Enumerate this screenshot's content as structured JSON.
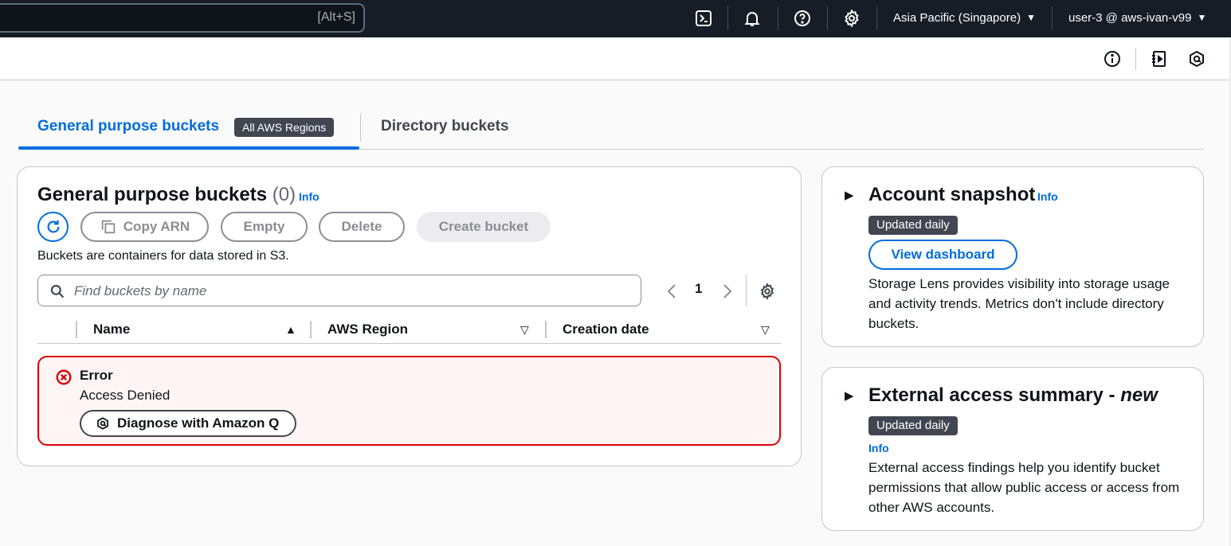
{
  "topnav": {
    "search_shortcut": "[Alt+S]",
    "region": "Asia Pacific (Singapore)",
    "account": "user-3 @ aws-ivan-v99"
  },
  "tabs": {
    "general": "General purpose buckets",
    "general_badge": "All AWS Regions",
    "directory": "Directory buckets"
  },
  "main": {
    "title": "General purpose buckets",
    "count": "(0)",
    "info": "Info",
    "buttons": {
      "copy_arn": "Copy ARN",
      "empty": "Empty",
      "delete": "Delete",
      "create": "Create bucket"
    },
    "description": "Buckets are containers for data stored in S3.",
    "search_placeholder": "Find buckets by name",
    "page_number": "1",
    "columns": [
      "Name",
      "AWS Region",
      "Creation date"
    ],
    "error": {
      "title": "Error",
      "message": "Access Denied",
      "button": "Diagnose with Amazon Q"
    }
  },
  "snapshot": {
    "title": "Account snapshot",
    "info": "Info",
    "badge": "Updated daily",
    "button": "View dashboard",
    "text": "Storage Lens provides visibility into storage usage and activity trends. Metrics don't include directory buckets."
  },
  "external": {
    "title": "External access summary - ",
    "title_new": "new",
    "badge": "Updated daily",
    "info": "Info",
    "text": "External access findings help you identify bucket permissions that allow public access or access from other AWS accounts."
  },
  "colors": {
    "nav_bg": "#161d26",
    "accent": "#006ce0",
    "error": "#db0000"
  }
}
